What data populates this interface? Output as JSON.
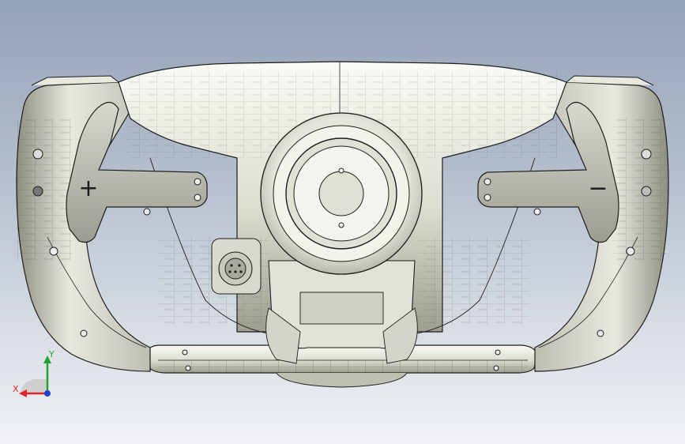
{
  "model": {
    "left_paddle_symbol": "+",
    "right_paddle_symbol": "−"
  },
  "triad": {
    "x_label": "X",
    "y_label": "Y",
    "x_color": "#e0242a",
    "y_color": "#1fa32a",
    "z_color": "#2244cc"
  },
  "colors": {
    "body_light": "#f1f1ea",
    "body_mid": "#d6d6c9",
    "body_dark": "#a6a697",
    "edge": "#1d1d1d"
  }
}
